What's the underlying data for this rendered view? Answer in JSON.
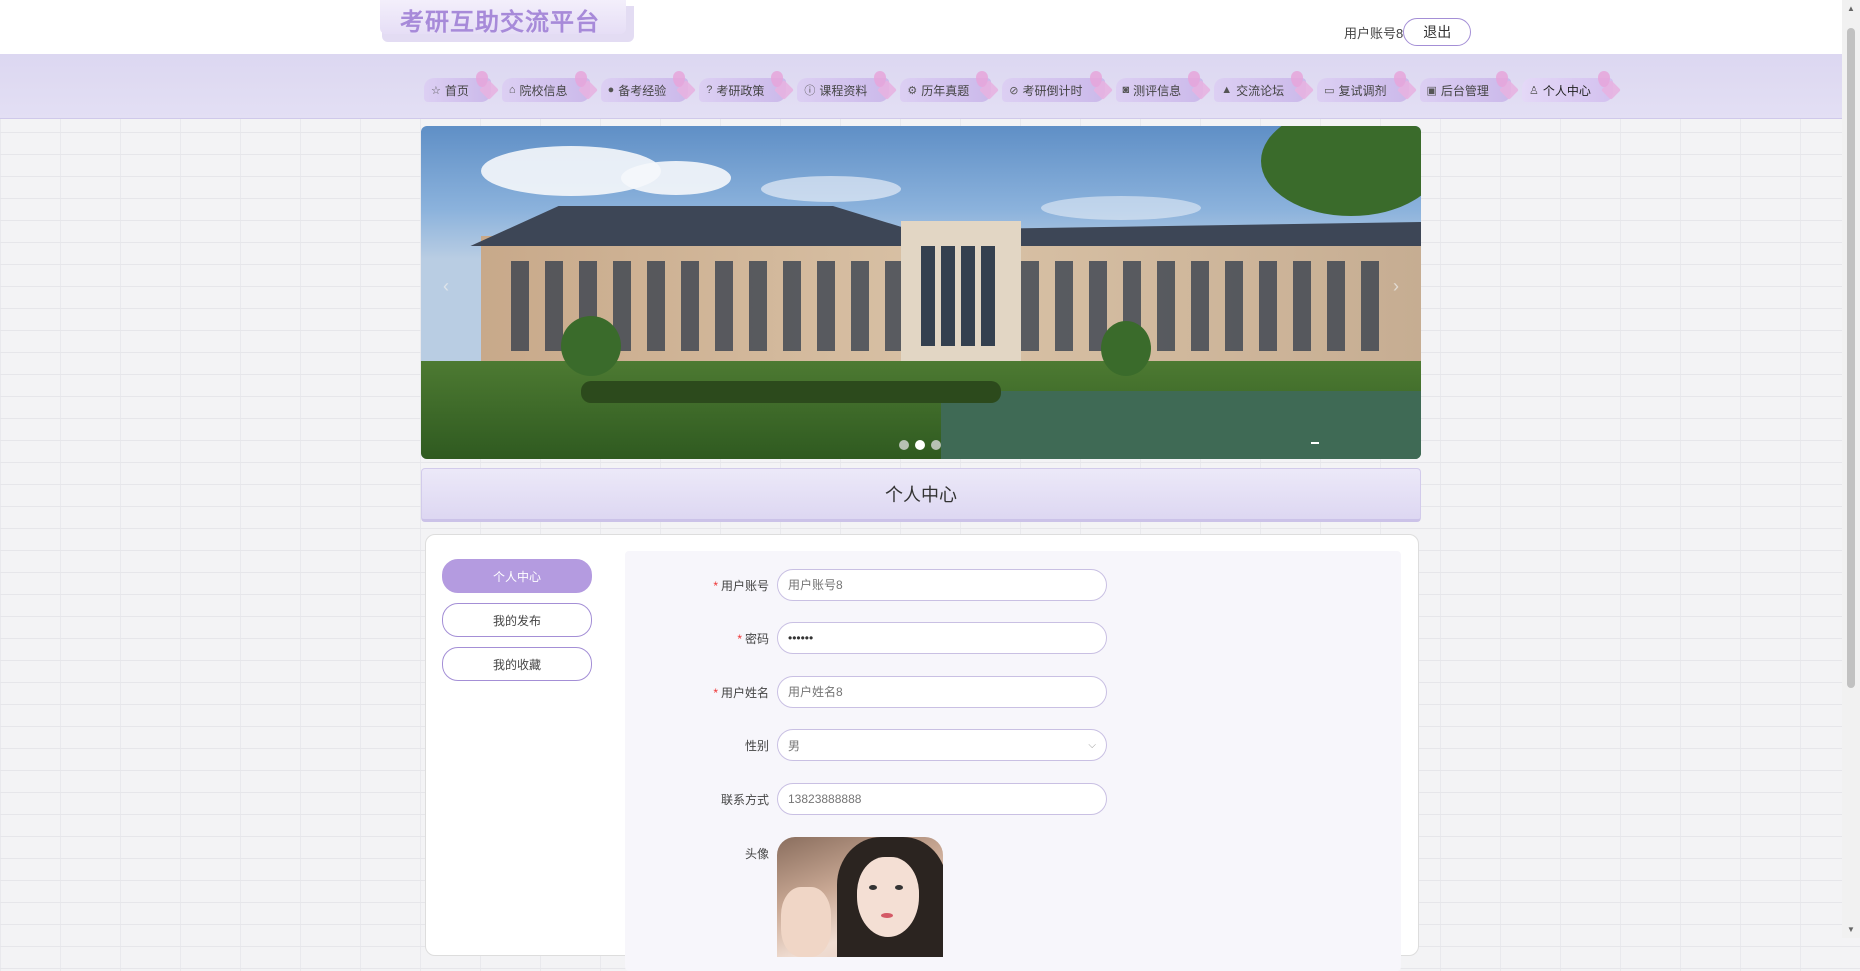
{
  "header": {
    "site_title": "考研互助交流平台",
    "user_label": "用户账号8",
    "logout_label": "退出"
  },
  "nav": {
    "items": [
      {
        "label": "首页",
        "icon": "home-icon",
        "glyph": "☆"
      },
      {
        "label": "院校信息",
        "icon": "school-icon",
        "glyph": "⌂"
      },
      {
        "label": "备考经验",
        "icon": "info-icon",
        "glyph": "●"
      },
      {
        "label": "考研政策",
        "icon": "question-icon",
        "glyph": "?"
      },
      {
        "label": "课程资料",
        "icon": "info-circle-icon",
        "glyph": "ⓘ"
      },
      {
        "label": "历年真题",
        "icon": "settings-icon",
        "glyph": "⚙"
      },
      {
        "label": "考研倒计时",
        "icon": "check-circle-icon",
        "glyph": "⊘"
      },
      {
        "label": "测评信息",
        "icon": "camera-icon",
        "glyph": "◙"
      },
      {
        "label": "交流论坛",
        "icon": "forum-icon",
        "glyph": "▲"
      },
      {
        "label": "复试调剂",
        "icon": "video-icon",
        "glyph": "▭"
      },
      {
        "label": "后台管理",
        "icon": "admin-icon",
        "glyph": "▣"
      },
      {
        "label": "个人中心",
        "icon": "user-icon",
        "glyph": "♙"
      }
    ],
    "active_index": 11
  },
  "banner": {
    "slide_count": 3,
    "active_slide": 1
  },
  "section": {
    "title": "个人中心"
  },
  "side_menu": {
    "items": [
      "个人中心",
      "我的发布",
      "我的收藏"
    ],
    "active_index": 0
  },
  "form": {
    "username": {
      "label": "用户账号",
      "required": true,
      "placeholder": "用户账号8",
      "value": ""
    },
    "password": {
      "label": "密码",
      "required": true,
      "value": "••••••"
    },
    "realname": {
      "label": "用户姓名",
      "required": true,
      "placeholder": "用户姓名8",
      "value": ""
    },
    "gender": {
      "label": "性别",
      "value": "男"
    },
    "contact": {
      "label": "联系方式",
      "placeholder": "13823888888",
      "value": ""
    },
    "avatar": {
      "label": "头像"
    }
  },
  "colors": {
    "accent": "#b49be0",
    "nav_bg": "#dcd7f1",
    "title_color": "#a78ad9",
    "required": "#ee3333"
  }
}
